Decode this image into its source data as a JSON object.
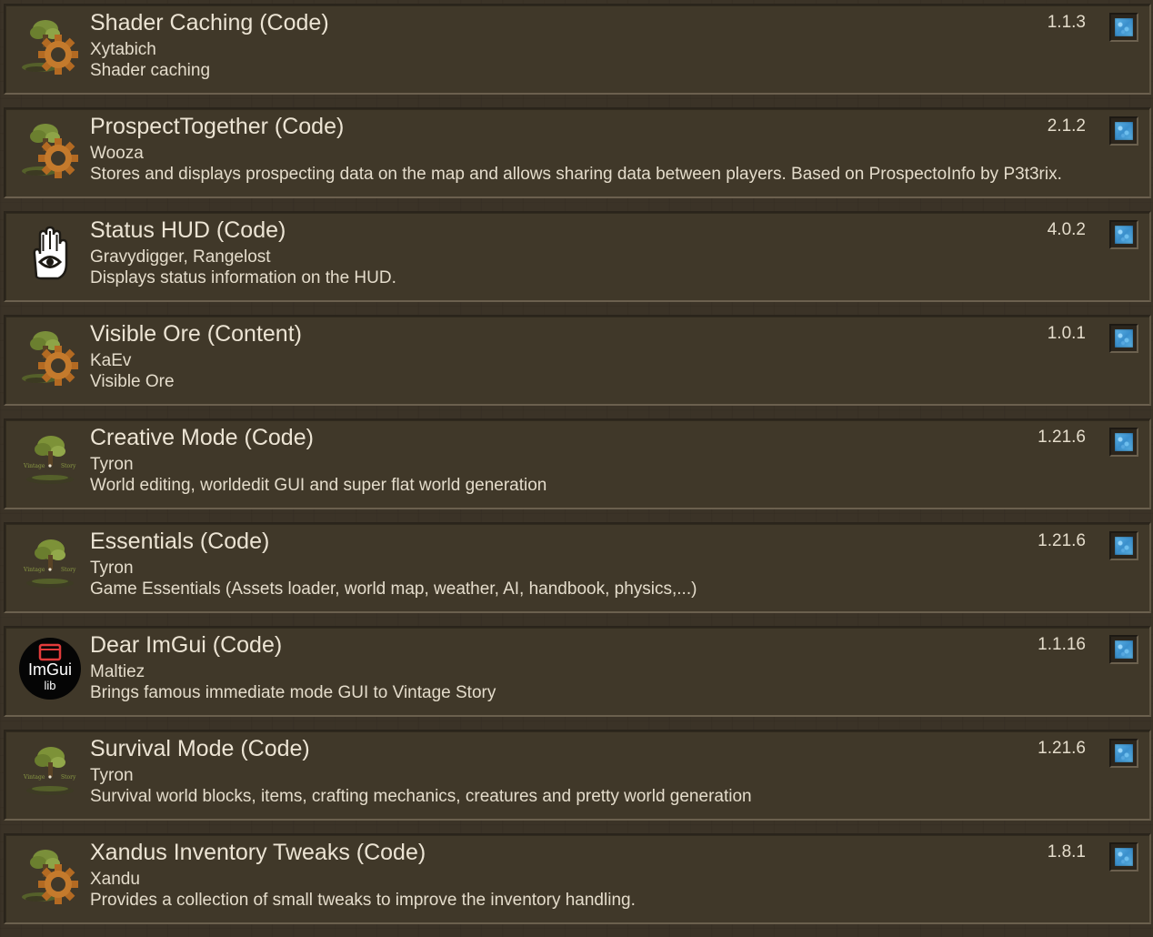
{
  "mods": [
    {
      "title": "Shader Caching (Code)",
      "author": "Xytabich",
      "description": "Shader caching",
      "version": "1.1.3",
      "icon": "gear-tree-icon",
      "enabled": true
    },
    {
      "title": "ProspectTogether (Code)",
      "author": "Wooza",
      "description": "Stores and displays prospecting data on the map and allows sharing data between players. Based on ProspectoInfo by P3t3rix.",
      "version": "2.1.2",
      "icon": "gear-tree-icon",
      "enabled": true
    },
    {
      "title": "Status HUD (Code)",
      "author": "Gravydigger, Rangelost",
      "description": "Displays status information on the HUD.",
      "version": "4.0.2",
      "icon": "hand-eye-icon",
      "enabled": true
    },
    {
      "title": "Visible Ore (Content)",
      "author": "KaEv",
      "description": "Visible Ore",
      "version": "1.0.1",
      "icon": "gear-tree-icon",
      "enabled": true
    },
    {
      "title": "Creative Mode (Code)",
      "author": "Tyron",
      "description": "World editing, worldedit GUI and super flat world generation",
      "version": "1.21.6",
      "icon": "vintage-story-tree-icon",
      "enabled": true
    },
    {
      "title": "Essentials (Code)",
      "author": "Tyron",
      "description": "Game Essentials (Assets loader, world map, weather, AI, handbook, physics,...)",
      "version": "1.21.6",
      "icon": "vintage-story-tree-icon",
      "enabled": true
    },
    {
      "title": "Dear ImGui (Code)",
      "author": "Maltiez",
      "description": "Brings famous immediate mode GUI to Vintage Story",
      "version": "1.1.16",
      "icon": "imgui-lib-icon",
      "enabled": true
    },
    {
      "title": "Survival Mode (Code)",
      "author": "Tyron",
      "description": "Survival world blocks, items, crafting mechanics, creatures and pretty world generation",
      "version": "1.21.6",
      "icon": "vintage-story-tree-icon",
      "enabled": true
    },
    {
      "title": "Xandus Inventory Tweaks (Code)",
      "author": "Xandu",
      "description": "Provides a collection of small tweaks to improve the inventory handling.",
      "version": "1.8.1",
      "icon": "gear-tree-icon",
      "enabled": true
    }
  ],
  "icon_text": {
    "imgui_main": "ImGui",
    "imgui_sub": "lib",
    "vs_left": "Vintage",
    "vs_right": "Story"
  },
  "colors": {
    "background": "#3b3327",
    "panel": "#403829",
    "text": "#ece4d4",
    "toggle_on": "#4aa3dc"
  }
}
